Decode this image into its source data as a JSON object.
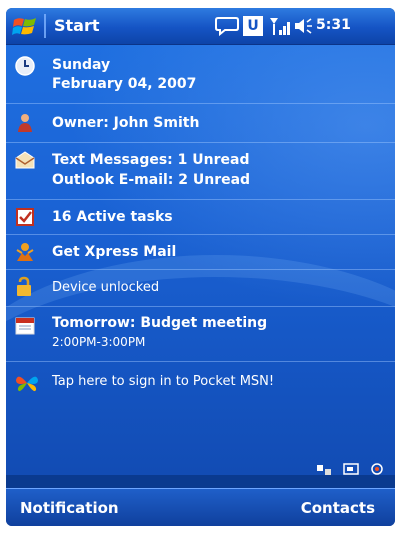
{
  "taskbar": {
    "start_label": "Start",
    "status_badge": "U",
    "time": "5:31"
  },
  "today": {
    "date_day": "Sunday",
    "date_full": "February 04, 2007",
    "owner": "Owner: John Smith",
    "text_messages": "Text Messages: 1 Unread",
    "outlook_email": "Outlook E-mail: 2 Unread",
    "tasks": "16 Active tasks",
    "xpress_mail": "Get Xpress Mail",
    "device_lock": "Device unlocked",
    "appointment_title": "Tomorrow: Budget meeting",
    "appointment_time": "2:00PM-3:00PM",
    "msn_signin": "Tap here to sign in to Pocket MSN!"
  },
  "softkeys": {
    "left": "Notification",
    "right": "Contacts"
  },
  "colors": {
    "accent": "#1a62d4",
    "titlebar": "#1554c4"
  }
}
